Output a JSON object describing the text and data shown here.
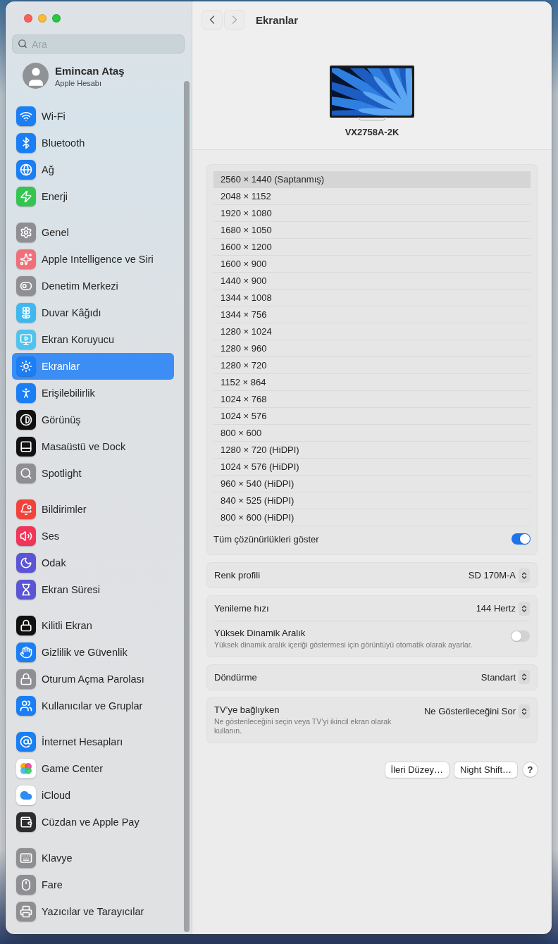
{
  "window": {
    "title": "Ekranlar"
  },
  "search": {
    "placeholder": "Ara"
  },
  "account": {
    "name": "Emincan Ataş",
    "subtitle": "Apple Hesabı"
  },
  "sidebar": {
    "groups": [
      {
        "items": [
          {
            "label": "Wi-Fi",
            "kind": "wifi",
            "color": "#1a7ef5",
            "selected": false
          },
          {
            "label": "Bluetooth",
            "kind": "bluetooth",
            "color": "#1a7ef5",
            "selected": false
          },
          {
            "label": "Ağ",
            "kind": "globe",
            "color": "#1a7ef5",
            "selected": false
          },
          {
            "label": "Enerji",
            "kind": "energy",
            "color": "#35c44f",
            "selected": false
          }
        ]
      },
      {
        "items": [
          {
            "label": "Genel",
            "kind": "gear",
            "color": "#8e8e93",
            "selected": false
          },
          {
            "label": "Apple Intelligence ve Siri",
            "kind": "sparkle",
            "color": "#f0707a",
            "selected": false
          },
          {
            "label": "Denetim Merkezi",
            "kind": "toggle",
            "color": "#8e8e93",
            "selected": false
          },
          {
            "label": "Duvar Kâğıdı",
            "kind": "flower",
            "color": "#3fb8ef",
            "selected": false
          },
          {
            "label": "Ekran Koruyucu",
            "kind": "screen",
            "color": "#4fc3f0",
            "selected": false
          },
          {
            "label": "Ekranlar",
            "kind": "sun",
            "color": "#1a7ef5",
            "selected": true
          },
          {
            "label": "Erişilebilirlik",
            "kind": "accessibility",
            "color": "#1a7ef5",
            "selected": false
          },
          {
            "label": "Görünüş",
            "kind": "contrast",
            "color": "#111111",
            "selected": false
          },
          {
            "label": "Masaüstü ve Dock",
            "kind": "dock",
            "color": "#111111",
            "selected": false
          },
          {
            "label": "Spotlight",
            "kind": "search",
            "color": "#8e8e93",
            "selected": false
          }
        ]
      },
      {
        "items": [
          {
            "label": "Bildirimler",
            "kind": "bell",
            "color": "#f2423a",
            "selected": false
          },
          {
            "label": "Ses",
            "kind": "speaker",
            "color": "#f0345a",
            "selected": false
          },
          {
            "label": "Odak",
            "kind": "moon",
            "color": "#5b55d6",
            "selected": false
          },
          {
            "label": "Ekran Süresi",
            "kind": "hourglass",
            "color": "#5b55d6",
            "selected": false
          }
        ]
      },
      {
        "items": [
          {
            "label": "Kilitli Ekran",
            "kind": "lock",
            "color": "#111111",
            "selected": false
          },
          {
            "label": "Gizlilik ve Güvenlik",
            "kind": "hand",
            "color": "#1a7ef5",
            "selected": false
          },
          {
            "label": "Oturum Açma Parolası",
            "kind": "lock",
            "color": "#8e8e93",
            "selected": false
          },
          {
            "label": "Kullanıcılar ve Gruplar",
            "kind": "users",
            "color": "#1a7ef5",
            "selected": false
          }
        ]
      },
      {
        "items": [
          {
            "label": "İnternet Hesapları",
            "kind": "at",
            "color": "#1a7ef5",
            "selected": false
          },
          {
            "label": "Game Center",
            "kind": "bubbles",
            "color": "#ffffff",
            "selected": false
          },
          {
            "label": "iCloud",
            "kind": "cloud",
            "color": "#ffffff",
            "selected": false
          },
          {
            "label": "Cüzdan ve Apple Pay",
            "kind": "wallet",
            "color": "#2c2c2e",
            "selected": false
          }
        ]
      },
      {
        "items": [
          {
            "label": "Klavye",
            "kind": "keyboard",
            "color": "#8e8e93",
            "selected": false
          },
          {
            "label": "Fare",
            "kind": "mouse",
            "color": "#8e8e93",
            "selected": false
          },
          {
            "label": "Yazıcılar ve Tarayıcılar",
            "kind": "printer",
            "color": "#8e8e93",
            "selected": false
          }
        ]
      }
    ]
  },
  "display": {
    "name": "VX2758A-2K"
  },
  "resolutions": [
    {
      "label": "2560 × 1440 (Saptanmış)",
      "selected": true
    },
    {
      "label": "2048 × 1152",
      "selected": false
    },
    {
      "label": "1920 × 1080",
      "selected": false
    },
    {
      "label": "1680 × 1050",
      "selected": false
    },
    {
      "label": "1600 × 1200",
      "selected": false
    },
    {
      "label": "1600 × 900",
      "selected": false
    },
    {
      "label": "1440 × 900",
      "selected": false
    },
    {
      "label": "1344 × 1008",
      "selected": false
    },
    {
      "label": "1344 × 756",
      "selected": false
    },
    {
      "label": "1280 × 1024",
      "selected": false
    },
    {
      "label": "1280 × 960",
      "selected": false
    },
    {
      "label": "1280 × 720",
      "selected": false
    },
    {
      "label": "1152 × 864",
      "selected": false
    },
    {
      "label": "1024 × 768",
      "selected": false
    },
    {
      "label": "1024 × 576",
      "selected": false
    },
    {
      "label": "800 × 600",
      "selected": false
    },
    {
      "label": "1280 × 720 (HiDPI)",
      "selected": false
    },
    {
      "label": "1024 × 576 (HiDPI)",
      "selected": false
    },
    {
      "label": "960 × 540 (HiDPI)",
      "selected": false
    },
    {
      "label": "840 × 525 (HiDPI)",
      "selected": false
    },
    {
      "label": "800 × 600 (HiDPI)",
      "selected": false
    }
  ],
  "show_all": {
    "label": "Tüm çözünürlükleri göster",
    "on": true
  },
  "cards": [
    {
      "rows": [
        {
          "kind": "popup",
          "label": "Renk profili",
          "value": "SD 170M-A"
        }
      ]
    },
    {
      "rows": [
        {
          "kind": "popup",
          "label": "Yenileme hızı",
          "value": "144 Hertz"
        },
        {
          "kind": "toggle",
          "label": "Yüksek Dinamik Aralık",
          "description": "Yüksek dinamik aralık içeriği göstermesi için görüntüyü otomatik olarak ayarlar.",
          "on": false
        }
      ]
    },
    {
      "rows": [
        {
          "kind": "popup",
          "label": "Döndürme",
          "value": "Standart"
        }
      ]
    },
    {
      "rows": [
        {
          "kind": "popup",
          "label": "TV’ye bağlıyken",
          "description": "Ne gösterileceğini seçin veya TV’yi ikincil ekran olarak kullanın.",
          "value": "Ne Gösterileceğini Sor"
        }
      ]
    }
  ],
  "buttons": [
    "İleri Düzey…",
    "Night Shift…"
  ],
  "help": "?"
}
